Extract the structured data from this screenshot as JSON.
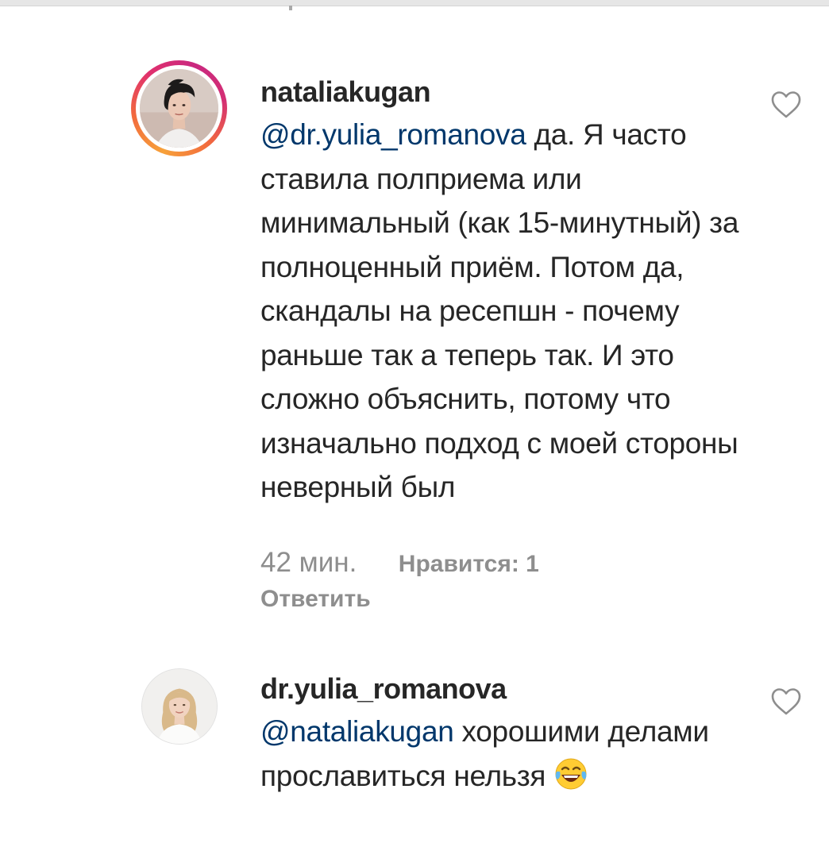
{
  "comments": [
    {
      "username": "nataliakugan",
      "mention": "@dr.yulia_romanova",
      "text": " да. Я часто ставила полприема или минимальный (как 15-минутный) за полноценный приём. Потом да, скандалы на ресепшн - почему раньше так а теперь так. И это сложно объяснить, потому что изначально подход с моей стороны неверный был",
      "timestamp": "42 мин.",
      "likes_label": "Нравится: 1",
      "reply_label": "Ответить",
      "has_story_ring": true,
      "heart_icon": "heart-outline-icon"
    },
    {
      "username": "dr.yulia_romanova",
      "mention": "@nataliakugan",
      "text": " хорошими делами прославиться нельзя ",
      "emoji": "😂",
      "emoji_icon": "face-with-tears-of-joy-icon",
      "heart_icon": "heart-outline-icon"
    }
  ],
  "colors": {
    "text": "#262626",
    "mention": "#00376b",
    "secondary": "#8e8e8e",
    "ring_start": "#f7a13a",
    "ring_end": "#c9287f"
  }
}
